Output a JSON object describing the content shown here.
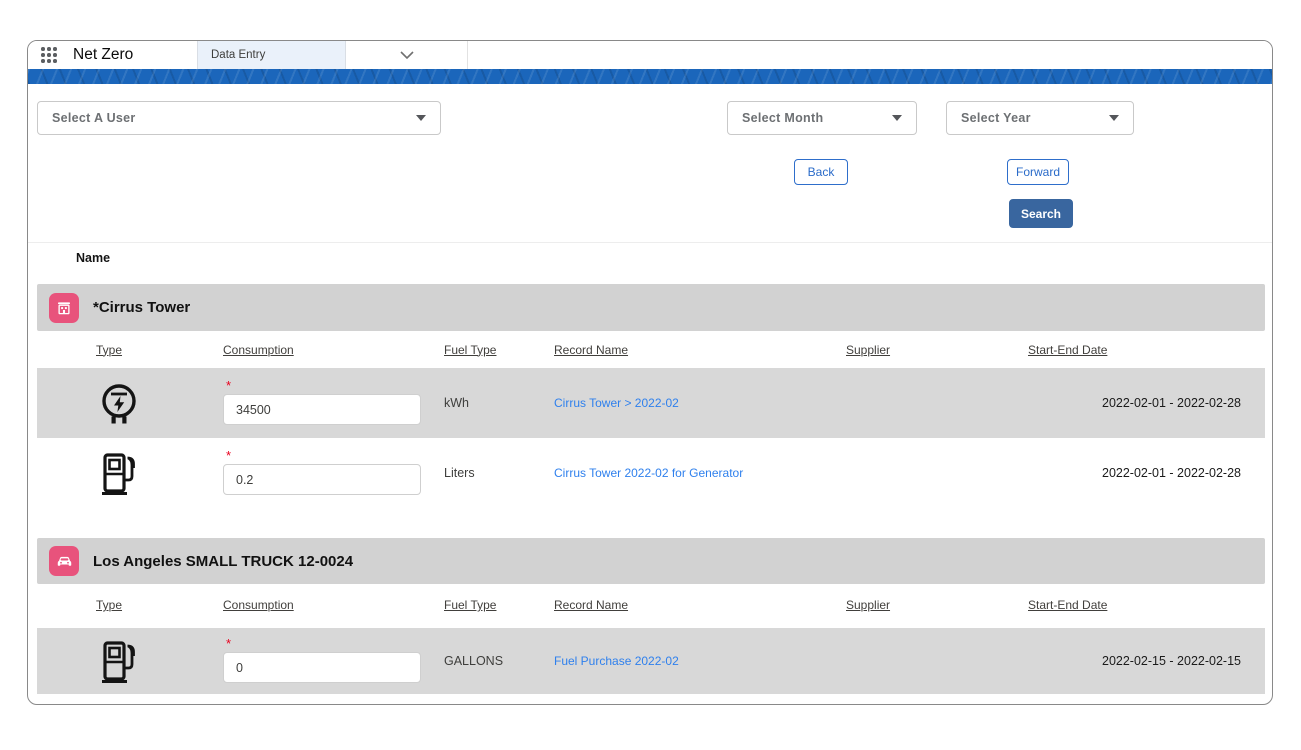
{
  "app": {
    "title": "Net Zero",
    "tab_label": "Data Entry"
  },
  "filters": {
    "user_placeholder": "Select A User",
    "month_placeholder": "Select Month",
    "year_placeholder": "Select Year",
    "back_label": "Back",
    "forward_label": "Forward",
    "search_label": "Search"
  },
  "table": {
    "name_header": "Name",
    "columns": [
      "Type",
      "Consumption",
      "Fuel Type",
      "Record Name",
      "Supplier",
      "Start-End Date"
    ],
    "sections": [
      {
        "name": "*Cirrus Tower",
        "icon": "building-icon",
        "rows": [
          {
            "type_icon": "electric-meter-icon",
            "consumption": "34500",
            "fuel_type": "kWh",
            "record_name": "Cirrus Tower > 2022-02",
            "supplier": "",
            "start_end_date": "2022-02-01 - 2022-02-28"
          },
          {
            "type_icon": "fuel-pump-icon",
            "consumption": "0.2",
            "fuel_type": "Liters",
            "record_name": "Cirrus Tower 2022-02 for Generator",
            "supplier": "",
            "start_end_date": "2022-02-01 - 2022-02-28"
          }
        ]
      },
      {
        "name": "Los Angeles SMALL TRUCK 12-0024",
        "icon": "car-icon",
        "rows": [
          {
            "type_icon": "fuel-pump-icon",
            "consumption": "0",
            "fuel_type": "GALLONS",
            "record_name": "Fuel Purchase 2022-02",
            "supplier": "",
            "start_end_date": "2022-02-15 - 2022-02-15"
          }
        ]
      }
    ]
  },
  "colors": {
    "brand_band": "#1b66bb",
    "tab_background": "#eaf1fa",
    "link_blue": "#2f80ed",
    "section_icon_pink": "#e8537c",
    "search_button": "#39669f",
    "outline_button_blue": "#2e6ecb",
    "section_bar_grey": "#d2d2d2",
    "row_grey": "#d8d8d8",
    "required_red": "#e8001e"
  }
}
